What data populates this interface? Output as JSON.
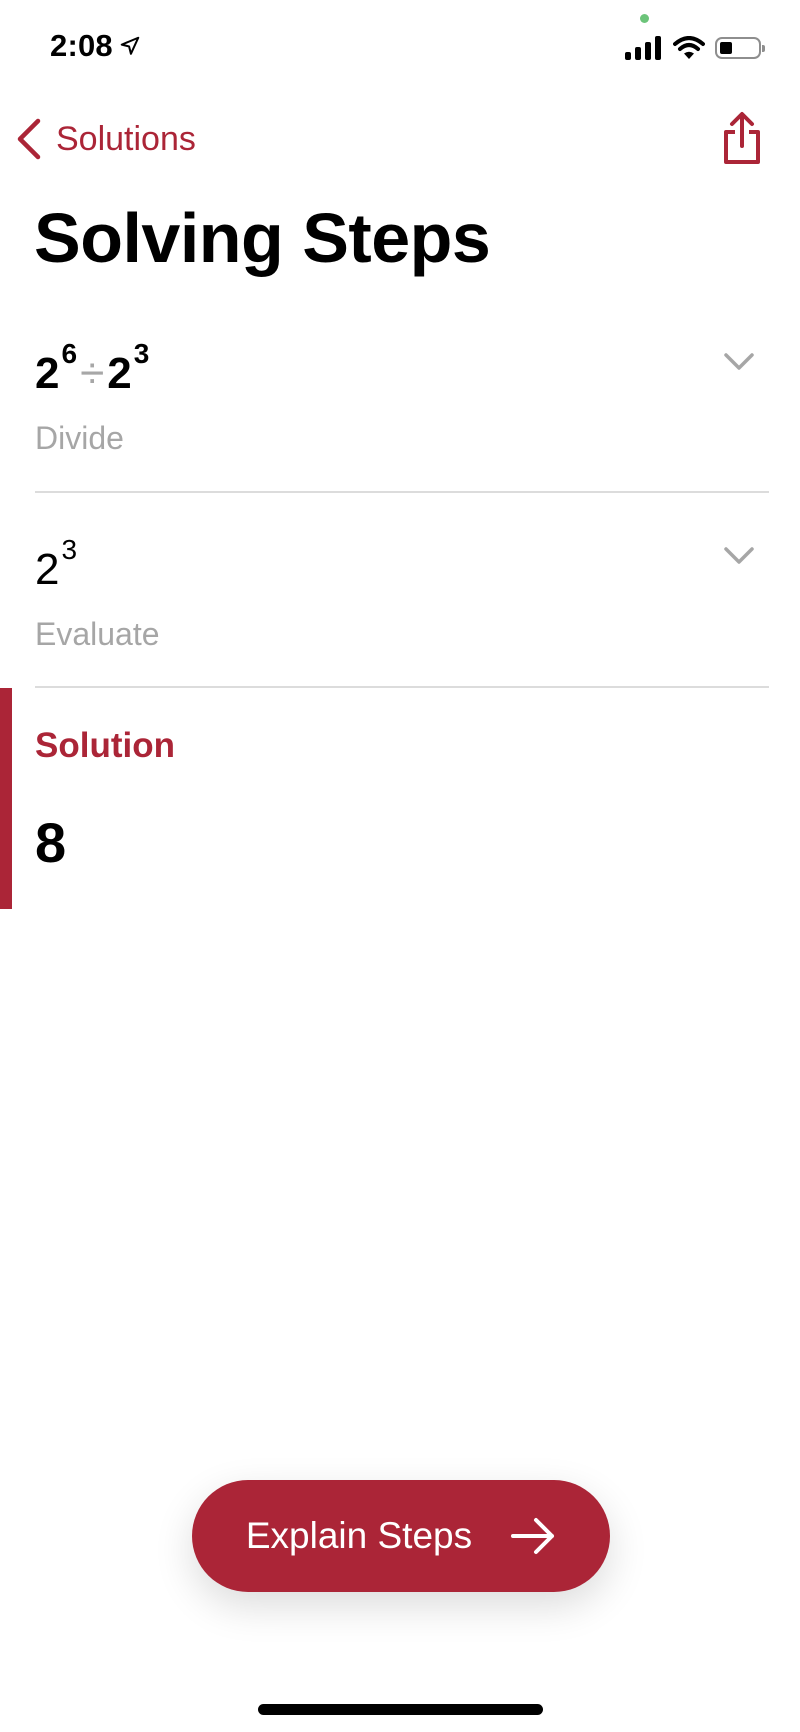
{
  "theme": {
    "accent": "#ab2537",
    "secondary_text": "#a6a6a6",
    "divider": "#dcdcdc"
  },
  "status_bar": {
    "time": "2:08",
    "location_icon": "location-arrow-icon",
    "signal_icon": "cellular-signal-icon",
    "wifi_icon": "wifi-icon",
    "battery_icon": "battery-low-icon",
    "battery_level_fraction": 0.25
  },
  "nav": {
    "back_label": "Solutions",
    "back_icon": "chevron-left-icon",
    "share_icon": "share-icon"
  },
  "page": {
    "title": "Solving Steps"
  },
  "steps": [
    {
      "base1": "2",
      "exp1": "6",
      "operator": "÷",
      "base2": "2",
      "exp2": "3",
      "description": "Divide",
      "chevron_icon": "chevron-down-icon"
    },
    {
      "base1": "2",
      "exp1": "3",
      "description": "Evaluate",
      "chevron_icon": "chevron-down-icon"
    }
  ],
  "solution": {
    "label": "Solution",
    "value": "8"
  },
  "action": {
    "label": "Explain Steps",
    "icon": "arrow-right-icon"
  }
}
